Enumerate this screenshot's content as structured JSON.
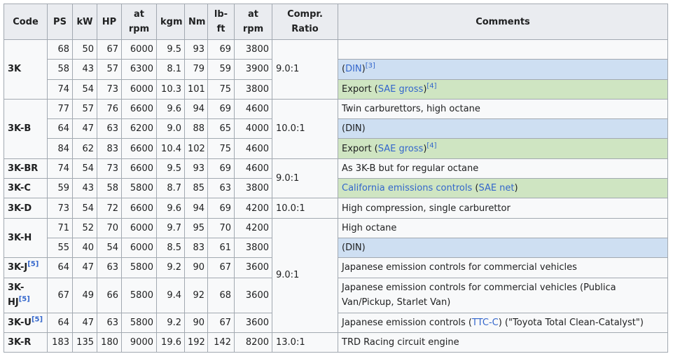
{
  "headers": {
    "code": "Code",
    "ps": "PS",
    "kw": "kW",
    "hp": "HP",
    "at_rpm_1": "at rpm",
    "kgm": "kgm",
    "nm": "Nm",
    "lbft": "lb-ft",
    "at_rpm_2": "at rpm",
    "ratio": "Compr. Ratio",
    "comments": "Comments"
  },
  "codes": {
    "k3": "3K",
    "k3b": "3K-B",
    "k3br": "3K-BR",
    "k3c": "3K-C",
    "k3d": "3K-D",
    "k3h": "3K-H",
    "k3j": "3K-J",
    "k3hj": "3K-HJ",
    "k3u": "3K-U",
    "k3r": "3K-R"
  },
  "refs": {
    "r3": "[3]",
    "r4": "[4]",
    "r5": "[5]"
  },
  "ratios": {
    "r1": "9.0:1",
    "r2": "10.0:1",
    "r3": "9.0:1",
    "r4": "10.0:1",
    "r5": "9.0:1",
    "r6": "13.0:1"
  },
  "rows": [
    {
      "ps": "68",
      "kw": "50",
      "hp": "67",
      "rpm1": "6000",
      "kgm": "9.5",
      "nm": "93",
      "lbft": "69",
      "rpm2": "3800"
    },
    {
      "ps": "58",
      "kw": "43",
      "hp": "57",
      "rpm1": "6300",
      "kgm": "8.1",
      "nm": "79",
      "lbft": "59",
      "rpm2": "3900"
    },
    {
      "ps": "74",
      "kw": "54",
      "hp": "73",
      "rpm1": "6000",
      "kgm": "10.3",
      "nm": "101",
      "lbft": "75",
      "rpm2": "3800"
    },
    {
      "ps": "77",
      "kw": "57",
      "hp": "76",
      "rpm1": "6600",
      "kgm": "9.6",
      "nm": "94",
      "lbft": "69",
      "rpm2": "4600"
    },
    {
      "ps": "64",
      "kw": "47",
      "hp": "63",
      "rpm1": "6200",
      "kgm": "9.0",
      "nm": "88",
      "lbft": "65",
      "rpm2": "4000"
    },
    {
      "ps": "84",
      "kw": "62",
      "hp": "83",
      "rpm1": "6600",
      "kgm": "10.4",
      "nm": "102",
      "lbft": "75",
      "rpm2": "4600"
    },
    {
      "ps": "74",
      "kw": "54",
      "hp": "73",
      "rpm1": "6600",
      "kgm": "9.5",
      "nm": "93",
      "lbft": "69",
      "rpm2": "4600"
    },
    {
      "ps": "59",
      "kw": "43",
      "hp": "58",
      "rpm1": "5800",
      "kgm": "8.7",
      "nm": "85",
      "lbft": "63",
      "rpm2": "3800"
    },
    {
      "ps": "73",
      "kw": "54",
      "hp": "72",
      "rpm1": "6600",
      "kgm": "9.6",
      "nm": "94",
      "lbft": "69",
      "rpm2": "4200"
    },
    {
      "ps": "71",
      "kw": "52",
      "hp": "70",
      "rpm1": "6000",
      "kgm": "9.7",
      "nm": "95",
      "lbft": "70",
      "rpm2": "4200"
    },
    {
      "ps": "55",
      "kw": "40",
      "hp": "54",
      "rpm1": "6000",
      "kgm": "8.5",
      "nm": "83",
      "lbft": "61",
      "rpm2": "3800"
    },
    {
      "ps": "64",
      "kw": "47",
      "hp": "63",
      "rpm1": "5800",
      "kgm": "9.2",
      "nm": "90",
      "lbft": "67",
      "rpm2": "3600"
    },
    {
      "ps": "67",
      "kw": "49",
      "hp": "66",
      "rpm1": "5800",
      "kgm": "9.4",
      "nm": "92",
      "lbft": "68",
      "rpm2": "3600"
    },
    {
      "ps": "64",
      "kw": "47",
      "hp": "63",
      "rpm1": "5800",
      "kgm": "9.2",
      "nm": "90",
      "lbft": "67",
      "rpm2": "3600"
    },
    {
      "ps": "183",
      "kw": "135",
      "hp": "180",
      "rpm1": "9000",
      "kgm": "19.6",
      "nm": "192",
      "lbft": "142",
      "rpm2": "8200"
    }
  ],
  "comments": {
    "c1": "",
    "c2_open": "(",
    "c2_link": "DIN",
    "c2_close": ")",
    "c3_pre": "Export (",
    "c3_link": "SAE gross",
    "c3_close": ")",
    "c4": "Twin carburettors, high octane",
    "c5": "(DIN)",
    "c6_pre": "Export (",
    "c6_link": "SAE gross",
    "c6_close": ")",
    "c7": "As 3K-B but for regular octane",
    "c8_link1": "California emissions controls",
    "c8_mid": " (",
    "c8_link2": "SAE net",
    "c8_close": ")",
    "c9": "High compression, single carburettor",
    "c10": "High octane",
    "c11": "(DIN)",
    "c12": "Japanese emission controls for commercial vehicles",
    "c13": "Japanese emission controls for commercial vehicles (Publica Van/Pickup, Starlet Van)",
    "c14_pre": "Japanese emission controls (",
    "c14_link": "TTC-C",
    "c14_post": ") (\"Toyota Total Clean-Catalyst\")",
    "c15": "TRD Racing circuit engine"
  },
  "colors": {
    "header_bg": "#eaecf0",
    "cell_bg": "#f8f9fa",
    "din_blue": "#cedff2",
    "sae_green": "#cfe5c2",
    "link": "#3366cc",
    "border": "#a2a9b1"
  }
}
